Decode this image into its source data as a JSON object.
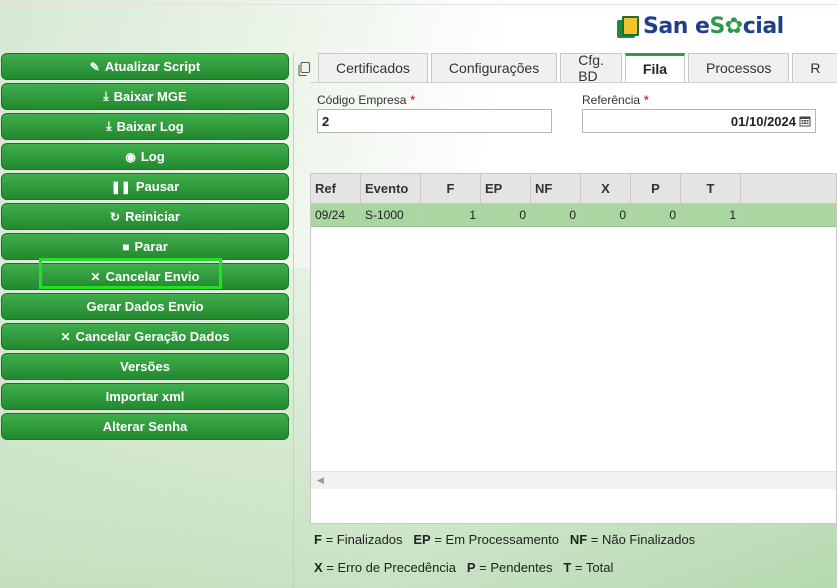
{
  "logo": {
    "text_a": "San e",
    "text_b": "S",
    "text_c": "cial"
  },
  "sidebar": {
    "buttons": [
      {
        "label": "Atualizar Script",
        "icon": "pencil-icon"
      },
      {
        "label": "Baixar MGE",
        "icon": "download-icon"
      },
      {
        "label": "Baixar Log",
        "icon": "download-icon"
      },
      {
        "label": "Log",
        "icon": "eye-icon"
      },
      {
        "label": "Pausar",
        "icon": "pause-icon"
      },
      {
        "label": "Reiniciar",
        "icon": "refresh-icon"
      },
      {
        "label": "Parar",
        "icon": "stop-icon"
      },
      {
        "label": "Cancelar Envio",
        "icon": "close-icon"
      },
      {
        "label": "Gerar Dados Envio",
        "icon": ""
      },
      {
        "label": "Cancelar Geração Dados",
        "icon": "close-icon"
      },
      {
        "label": "Versões",
        "icon": ""
      },
      {
        "label": "Importar xml",
        "icon": ""
      },
      {
        "label": "Alterar Senha",
        "icon": ""
      }
    ]
  },
  "tabs": [
    {
      "label": "Certificados",
      "active": false
    },
    {
      "label": "Configurações",
      "active": false
    },
    {
      "label": "Cfg. BD",
      "active": false
    },
    {
      "label": "Fila",
      "active": true
    },
    {
      "label": "Processos",
      "active": false
    },
    {
      "label": "R",
      "active": false
    }
  ],
  "form": {
    "empresa_label": "Código Empresa",
    "empresa_value": "2",
    "referencia_label": "Referência",
    "referencia_value": "01/10/2024",
    "required_mark": "*"
  },
  "table": {
    "columns": [
      "Ref",
      "Evento",
      "F",
      "EP",
      "NF",
      "X",
      "P",
      "T"
    ],
    "rows": [
      [
        "09/24",
        "S-1000",
        "1",
        "0",
        "0",
        "0",
        "0",
        "1"
      ]
    ]
  },
  "legend": {
    "line1": [
      {
        "key": "F",
        "text": " = Finalizados"
      },
      {
        "key": "EP",
        "text": " = Em Processamento"
      },
      {
        "key": "NF",
        "text": " = Não Finalizados"
      }
    ],
    "line2": [
      {
        "key": "X",
        "text": " = Erro de Precedência"
      },
      {
        "key": "P",
        "text": " = Pendentes"
      },
      {
        "key": "T",
        "text": " = Total"
      }
    ]
  },
  "colors": {
    "accent": "#2e9a46",
    "selected_row": "#a9d6a1",
    "highlight": "#22e022"
  }
}
